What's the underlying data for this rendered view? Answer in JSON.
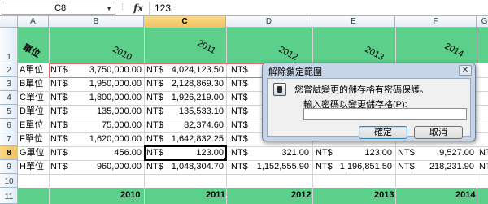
{
  "formula_bar": {
    "name_box": "C8",
    "fx_symbol": "fx",
    "value": "123"
  },
  "column_headers": [
    "A",
    "B",
    "C",
    "D",
    "E",
    "F",
    "G"
  ],
  "row_headers": [
    "1",
    "2",
    "3",
    "4",
    "5",
    "6",
    "7",
    "8",
    "9",
    "10",
    "11"
  ],
  "selected": {
    "column": "C",
    "row": "8"
  },
  "header_row": {
    "unit_label": "單位",
    "years": [
      "2010",
      "2011",
      "2012",
      "2013",
      "2014"
    ]
  },
  "currency": "NT$",
  "rows": [
    {
      "unit": "A單位",
      "values": [
        "3,750,000.00",
        "4,024,123.50",
        "",
        "",
        "",
        ""
      ]
    },
    {
      "unit": "B單位",
      "values": [
        "1,950,000.00",
        "2,128,869.30",
        "",
        "",
        "",
        ""
      ]
    },
    {
      "unit": "C單位",
      "values": [
        "1,800,000.00",
        "1,926,219.00",
        "",
        "",
        "",
        ""
      ]
    },
    {
      "unit": "D單位",
      "values": [
        "135,000.00",
        "135,533.10",
        "",
        "",
        "",
        ""
      ]
    },
    {
      "unit": "E單位",
      "values": [
        "75,000.00",
        "82,374.60",
        "",
        "",
        "",
        ""
      ]
    },
    {
      "unit": "F單位",
      "values": [
        "1,620,000.00",
        "1,642,832.25",
        "",
        "",
        "",
        ""
      ]
    },
    {
      "unit": "G單位",
      "values": [
        "456.00",
        "123.00",
        "321.00",
        "123.00",
        "9,527.00",
        ""
      ]
    },
    {
      "unit": "H單位",
      "values": [
        "960,000.00",
        "1,048,304.70",
        "1,152,555.90",
        "1,196,851.50",
        "218,231.90",
        ""
      ]
    }
  ],
  "footer_years": [
    "2010",
    "2011",
    "2012",
    "2013",
    "2014"
  ],
  "dialog": {
    "title": "解除鎖定範圍",
    "close_glyph": "✕",
    "message": "您嘗試變更的儲存格有密碼保護。",
    "prompt_label": "輸入密碼以變更儲存格(P):",
    "password_value": "",
    "ok_label": "確定",
    "cancel_label": "取消"
  },
  "colors": {
    "accent_band": "#5ccf8a",
    "selection_header": "#f1c15f",
    "protected_border": "#e46a6a"
  }
}
